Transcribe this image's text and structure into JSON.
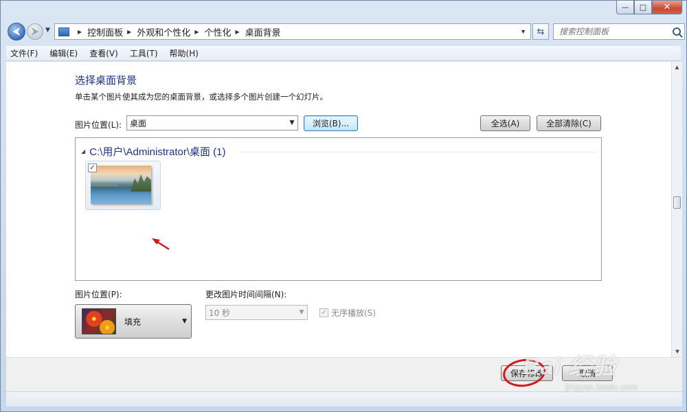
{
  "window": {
    "controls": {
      "minimize": "—",
      "maximize": "□",
      "close": "✕"
    }
  },
  "address": {
    "crumbs": [
      "控制面板",
      "外观和个性化",
      "个性化",
      "桌面背景"
    ]
  },
  "search": {
    "placeholder": "搜索控制面板"
  },
  "menu": [
    "文件(F)",
    "编辑(E)",
    "查看(V)",
    "工具(T)",
    "帮助(H)"
  ],
  "page": {
    "title": "选择桌面背景",
    "description": "单击某个图片使其成为您的桌面背景，或选择多个图片创建一个幻灯片。",
    "location_label": "图片位置(L):",
    "location_value": "桌面",
    "browse_label": "浏览(B)...",
    "select_all_label": "全选(A)",
    "clear_all_label": "全部清除(C)"
  },
  "gallery": {
    "group_title": "C:\\用户\\Administrator\\桌面 (1)",
    "items": [
      {
        "checked": true,
        "icon": "lake-landscape"
      }
    ]
  },
  "position": {
    "label": "图片位置(P):",
    "value": "填充"
  },
  "interval": {
    "label": "更改图片时间间隔(N):",
    "value": "10 秒"
  },
  "shuffle": {
    "label": "无序播放(S)",
    "checked": true,
    "disabled": true
  },
  "footer": {
    "save_label": "保存修改",
    "cancel_label": "取消"
  },
  "watermark": {
    "text": "Bai 经验",
    "url": "jingyan.baidu.com"
  },
  "colors": {
    "accent": "#1e3287",
    "highlight": "#d3171c"
  }
}
